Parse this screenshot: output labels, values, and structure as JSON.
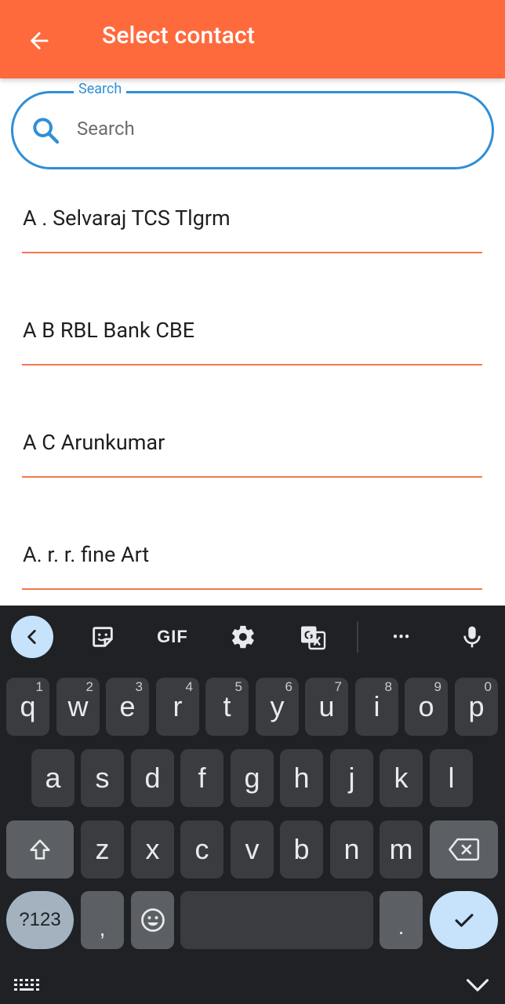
{
  "app_bar": {
    "title": "Select contact",
    "back_icon": "arrow-left-icon",
    "color": "#ff6a3d"
  },
  "search": {
    "legend": "Search",
    "placeholder": "Search",
    "value": "",
    "icon": "search-icon",
    "accent": "#2f8fd6"
  },
  "contacts": [
    {
      "name": "A . Selvaraj TCS Tlgrm"
    },
    {
      "name": "A B RBL Bank CBE"
    },
    {
      "name": "A C Arunkumar"
    },
    {
      "name": "A. r. r. fine Art"
    }
  ],
  "keyboard": {
    "toolbar": {
      "gif_label": "GIF",
      "more_label": "•••"
    },
    "row1": [
      {
        "key": "q",
        "hint": "1"
      },
      {
        "key": "w",
        "hint": "2"
      },
      {
        "key": "e",
        "hint": "3"
      },
      {
        "key": "r",
        "hint": "4"
      },
      {
        "key": "t",
        "hint": "5"
      },
      {
        "key": "y",
        "hint": "6"
      },
      {
        "key": "u",
        "hint": "7"
      },
      {
        "key": "i",
        "hint": "8"
      },
      {
        "key": "o",
        "hint": "9"
      },
      {
        "key": "p",
        "hint": "0"
      }
    ],
    "row2": [
      "a",
      "s",
      "d",
      "f",
      "g",
      "h",
      "j",
      "k",
      "l"
    ],
    "row3": [
      "z",
      "x",
      "c",
      "v",
      "b",
      "n",
      "m"
    ],
    "symbols_label": "?123",
    "comma_label": ",",
    "period_label": "."
  }
}
